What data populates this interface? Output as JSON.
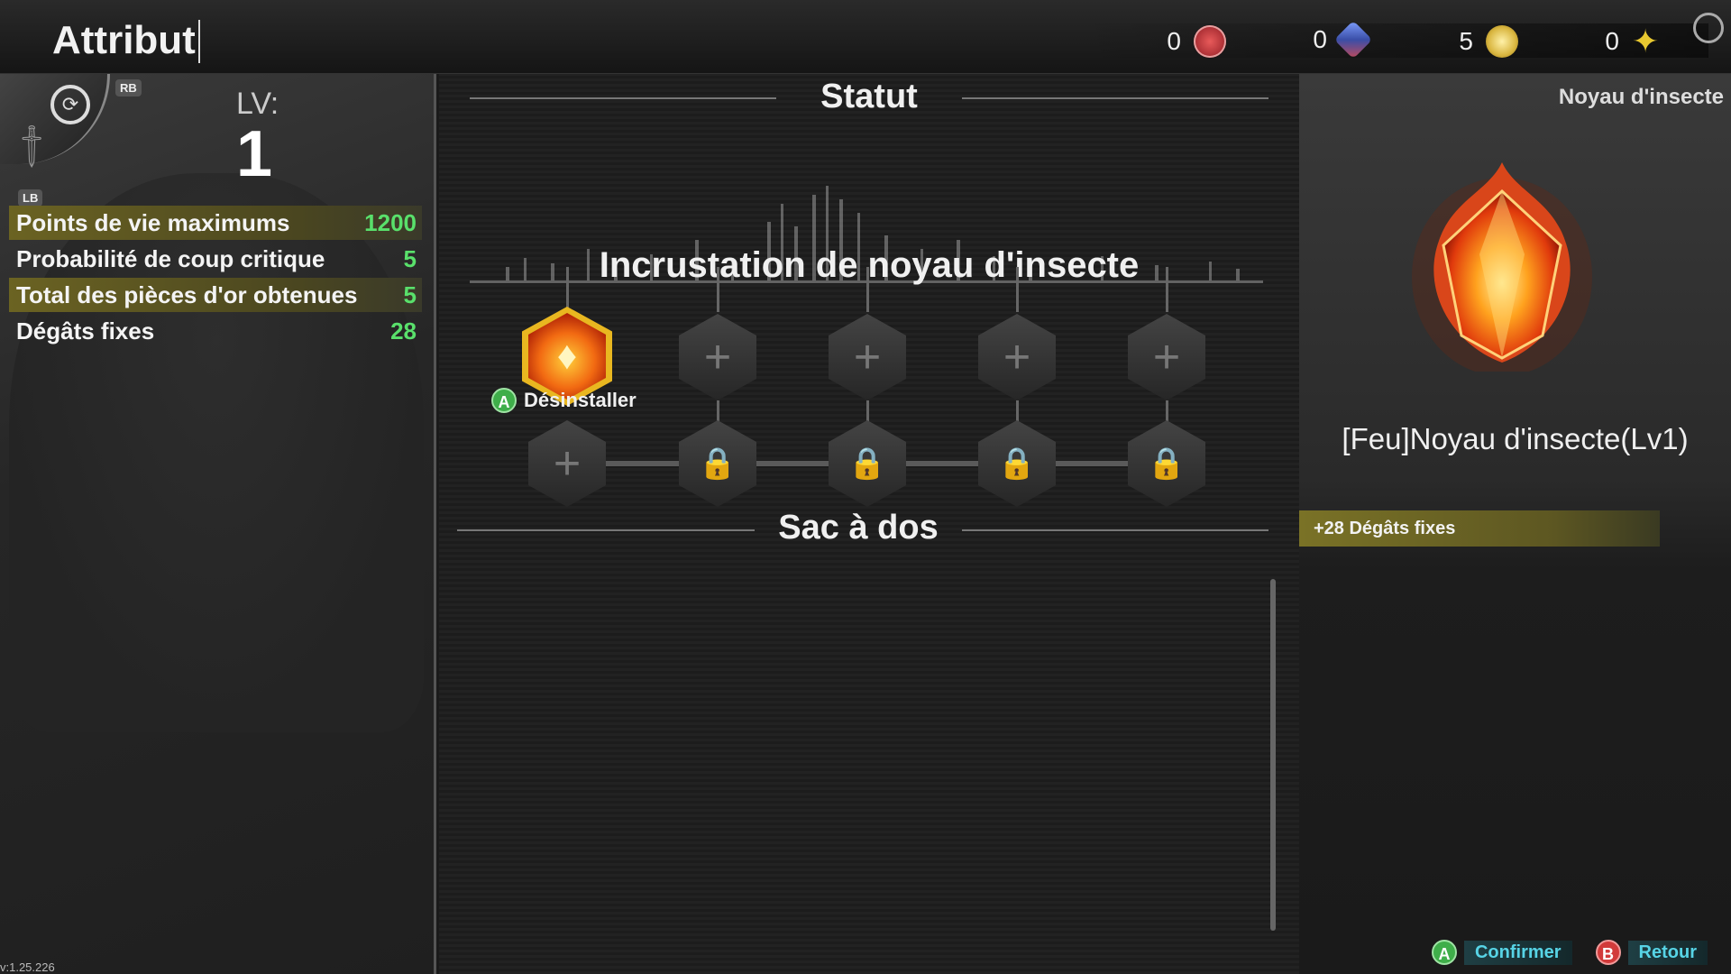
{
  "header": {
    "title": "Attribut",
    "currencies": [
      {
        "amount": "0",
        "icon": "red-emblem-icon",
        "color": "#c8303a"
      },
      {
        "amount": "0",
        "icon": "blue-crystal-icon",
        "color": "#4a6fd0"
      },
      {
        "amount": "5",
        "icon": "gold-coin-icon",
        "color": "#d9b640"
      },
      {
        "amount": "0",
        "icon": "star-icon",
        "color": "#e0c040"
      }
    ]
  },
  "left_panel": {
    "rb": "RB",
    "lb": "LB",
    "lv_label": "LV:",
    "lv_value": "1",
    "stats": [
      {
        "label": "Points de vie maximums",
        "value": "1200",
        "highlight": true
      },
      {
        "label": "Probabilité de coup critique",
        "value": "5",
        "highlight": false
      },
      {
        "label": "Total des pièces d'or obtenues",
        "value": "5",
        "highlight": true
      },
      {
        "label": "Dégâts fixes",
        "value": "28",
        "highlight": false
      }
    ],
    "version": "v:1.25.226"
  },
  "center_panel": {
    "status_title": "Statut",
    "inlay_title": "Incrustation de noyau d'insecte",
    "uninstall_button": "A",
    "uninstall_label": "Désinstaller",
    "backpack_title": "Sac à dos"
  },
  "right_panel": {
    "category": "Noyau d'insecte",
    "item_name": "[Feu]Noyau d'insecte(Lv1)",
    "effect": "+28 Dégâts fixes",
    "confirm_button": "A",
    "confirm_label": "Confirmer",
    "back_button": "B",
    "back_label": "Retour"
  },
  "colors": {
    "accent_gold": "#e9b720",
    "stat_value_green": "#59e06b",
    "footer_cyan": "#57d4e6"
  }
}
